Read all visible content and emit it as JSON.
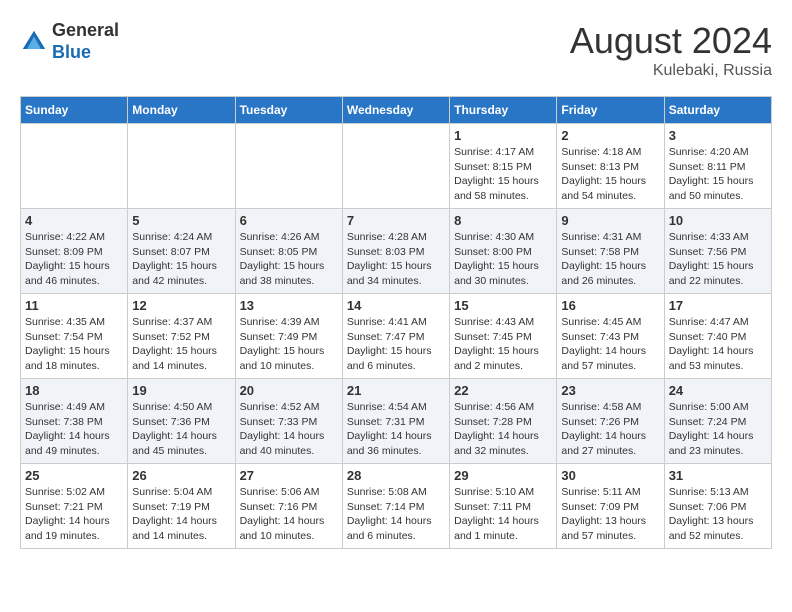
{
  "header": {
    "logo_line1": "General",
    "logo_line2": "Blue",
    "month": "August 2024",
    "location": "Kulebaki, Russia"
  },
  "weekdays": [
    "Sunday",
    "Monday",
    "Tuesday",
    "Wednesday",
    "Thursday",
    "Friday",
    "Saturday"
  ],
  "weeks": [
    [
      {
        "day": "",
        "info": ""
      },
      {
        "day": "",
        "info": ""
      },
      {
        "day": "",
        "info": ""
      },
      {
        "day": "",
        "info": ""
      },
      {
        "day": "1",
        "info": "Sunrise: 4:17 AM\nSunset: 8:15 PM\nDaylight: 15 hours\nand 58 minutes."
      },
      {
        "day": "2",
        "info": "Sunrise: 4:18 AM\nSunset: 8:13 PM\nDaylight: 15 hours\nand 54 minutes."
      },
      {
        "day": "3",
        "info": "Sunrise: 4:20 AM\nSunset: 8:11 PM\nDaylight: 15 hours\nand 50 minutes."
      }
    ],
    [
      {
        "day": "4",
        "info": "Sunrise: 4:22 AM\nSunset: 8:09 PM\nDaylight: 15 hours\nand 46 minutes."
      },
      {
        "day": "5",
        "info": "Sunrise: 4:24 AM\nSunset: 8:07 PM\nDaylight: 15 hours\nand 42 minutes."
      },
      {
        "day": "6",
        "info": "Sunrise: 4:26 AM\nSunset: 8:05 PM\nDaylight: 15 hours\nand 38 minutes."
      },
      {
        "day": "7",
        "info": "Sunrise: 4:28 AM\nSunset: 8:03 PM\nDaylight: 15 hours\nand 34 minutes."
      },
      {
        "day": "8",
        "info": "Sunrise: 4:30 AM\nSunset: 8:00 PM\nDaylight: 15 hours\nand 30 minutes."
      },
      {
        "day": "9",
        "info": "Sunrise: 4:31 AM\nSunset: 7:58 PM\nDaylight: 15 hours\nand 26 minutes."
      },
      {
        "day": "10",
        "info": "Sunrise: 4:33 AM\nSunset: 7:56 PM\nDaylight: 15 hours\nand 22 minutes."
      }
    ],
    [
      {
        "day": "11",
        "info": "Sunrise: 4:35 AM\nSunset: 7:54 PM\nDaylight: 15 hours\nand 18 minutes."
      },
      {
        "day": "12",
        "info": "Sunrise: 4:37 AM\nSunset: 7:52 PM\nDaylight: 15 hours\nand 14 minutes."
      },
      {
        "day": "13",
        "info": "Sunrise: 4:39 AM\nSunset: 7:49 PM\nDaylight: 15 hours\nand 10 minutes."
      },
      {
        "day": "14",
        "info": "Sunrise: 4:41 AM\nSunset: 7:47 PM\nDaylight: 15 hours\nand 6 minutes."
      },
      {
        "day": "15",
        "info": "Sunrise: 4:43 AM\nSunset: 7:45 PM\nDaylight: 15 hours\nand 2 minutes."
      },
      {
        "day": "16",
        "info": "Sunrise: 4:45 AM\nSunset: 7:43 PM\nDaylight: 14 hours\nand 57 minutes."
      },
      {
        "day": "17",
        "info": "Sunrise: 4:47 AM\nSunset: 7:40 PM\nDaylight: 14 hours\nand 53 minutes."
      }
    ],
    [
      {
        "day": "18",
        "info": "Sunrise: 4:49 AM\nSunset: 7:38 PM\nDaylight: 14 hours\nand 49 minutes."
      },
      {
        "day": "19",
        "info": "Sunrise: 4:50 AM\nSunset: 7:36 PM\nDaylight: 14 hours\nand 45 minutes."
      },
      {
        "day": "20",
        "info": "Sunrise: 4:52 AM\nSunset: 7:33 PM\nDaylight: 14 hours\nand 40 minutes."
      },
      {
        "day": "21",
        "info": "Sunrise: 4:54 AM\nSunset: 7:31 PM\nDaylight: 14 hours\nand 36 minutes."
      },
      {
        "day": "22",
        "info": "Sunrise: 4:56 AM\nSunset: 7:28 PM\nDaylight: 14 hours\nand 32 minutes."
      },
      {
        "day": "23",
        "info": "Sunrise: 4:58 AM\nSunset: 7:26 PM\nDaylight: 14 hours\nand 27 minutes."
      },
      {
        "day": "24",
        "info": "Sunrise: 5:00 AM\nSunset: 7:24 PM\nDaylight: 14 hours\nand 23 minutes."
      }
    ],
    [
      {
        "day": "25",
        "info": "Sunrise: 5:02 AM\nSunset: 7:21 PM\nDaylight: 14 hours\nand 19 minutes."
      },
      {
        "day": "26",
        "info": "Sunrise: 5:04 AM\nSunset: 7:19 PM\nDaylight: 14 hours\nand 14 minutes."
      },
      {
        "day": "27",
        "info": "Sunrise: 5:06 AM\nSunset: 7:16 PM\nDaylight: 14 hours\nand 10 minutes."
      },
      {
        "day": "28",
        "info": "Sunrise: 5:08 AM\nSunset: 7:14 PM\nDaylight: 14 hours\nand 6 minutes."
      },
      {
        "day": "29",
        "info": "Sunrise: 5:10 AM\nSunset: 7:11 PM\nDaylight: 14 hours\nand 1 minute."
      },
      {
        "day": "30",
        "info": "Sunrise: 5:11 AM\nSunset: 7:09 PM\nDaylight: 13 hours\nand 57 minutes."
      },
      {
        "day": "31",
        "info": "Sunrise: 5:13 AM\nSunset: 7:06 PM\nDaylight: 13 hours\nand 52 minutes."
      }
    ]
  ]
}
